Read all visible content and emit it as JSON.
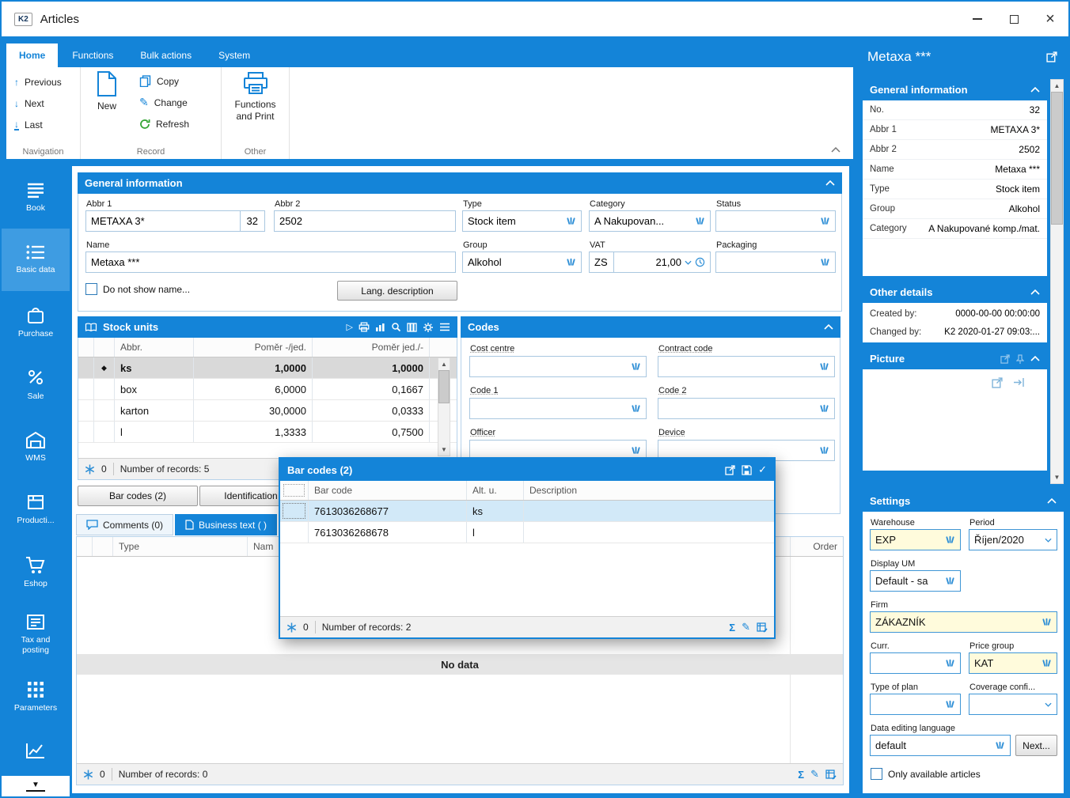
{
  "window": {
    "title": "Articles",
    "logo": "K2"
  },
  "icons": {
    "close": "×",
    "prev": "↑",
    "next": "↓",
    "last": "↓",
    "play": "▷",
    "check": "✓",
    "sigma": "Σ",
    "pencil": "✎",
    "diamond": "◆",
    "up": "▲",
    "down": "▼",
    "more": "▼"
  },
  "ribbon": {
    "tabs": [
      {
        "label": "Home"
      },
      {
        "label": "Functions"
      },
      {
        "label": "Bulk actions"
      },
      {
        "label": "System"
      }
    ],
    "groups": {
      "navigation": {
        "label": "Navigation",
        "previous": "Previous",
        "next": "Next",
        "last": "Last"
      },
      "record": {
        "label": "Record",
        "new": "New",
        "copy": "Copy",
        "change": "Change",
        "refresh": "Refresh"
      },
      "other": {
        "label": "Other",
        "functions_and_print": "Functions and Print"
      }
    }
  },
  "sidebar": {
    "items": [
      {
        "label": "Book"
      },
      {
        "label": "Basic data"
      },
      {
        "label": "Purchase"
      },
      {
        "label": "Sale"
      },
      {
        "label": "WMS"
      },
      {
        "label": "Producti..."
      },
      {
        "label": "Eshop"
      },
      {
        "label": "Tax and posting"
      },
      {
        "label": "Parameters"
      }
    ]
  },
  "general": {
    "title": "General information",
    "abbr1_label": "Abbr 1",
    "abbr1_value": "METAXA 3*",
    "abbr1_no": "32",
    "abbr2_label": "Abbr 2",
    "abbr2_value": "2502",
    "type_label": "Type",
    "type_value": "Stock item",
    "category_label": "Category",
    "category_value": "A Nakupovan...",
    "status_label": "Status",
    "name_label": "Name",
    "name_value": "Metaxa ***",
    "group_label": "Group",
    "group_value": "Alkohol",
    "vat_label": "VAT",
    "vat_code": "ZS",
    "vat_value": "21,00",
    "packaging_label": "Packaging",
    "do_not_show": "Do not show name...",
    "lang_button": "Lang. description"
  },
  "stock_units": {
    "title": "Stock units",
    "columns": [
      "Abbr.",
      "Poměr -/jed.",
      "Poměr jed./-"
    ],
    "rows": [
      {
        "abbr": "ks",
        "r1": "1,0000",
        "r2": "1,0000"
      },
      {
        "abbr": "box",
        "r1": "6,0000",
        "r2": "0,1667"
      },
      {
        "abbr": "karton",
        "r1": "30,0000",
        "r2": "0,0333"
      },
      {
        "abbr": "l",
        "r1": "1,3333",
        "r2": "0,7500"
      }
    ],
    "count": "0",
    "records": "Number of records: 5",
    "tab_barcodes": "Bar codes (2)",
    "tab_identification": "Identification n..."
  },
  "codes": {
    "title": "Codes",
    "cost_centre": "Cost centre",
    "contract_code": "Contract code",
    "code1": "Code 1",
    "code2": "Code 2",
    "officer": "Officer",
    "device": "Device"
  },
  "barcodes": {
    "title": "Bar codes (2)",
    "col_code": "Bar code",
    "col_alt": "Alt. u.",
    "col_desc": "Description",
    "rows": [
      {
        "code": "7613036268677",
        "alt": "ks"
      },
      {
        "code": "7613036268678",
        "alt": "l"
      }
    ],
    "count": "0",
    "records": "Number of records: 2"
  },
  "bottom": {
    "comments_tab": "Comments (0)",
    "business_tab": "Business text ( )",
    "col_type": "Type",
    "col_name": "Nam",
    "col_order": "Order",
    "no_data": "No data",
    "count": "0",
    "records": "Number of records: 0"
  },
  "right": {
    "title": "Metaxa ***",
    "general": {
      "title": "General information",
      "rows": [
        {
          "label": "No.",
          "value": "32"
        },
        {
          "label": "Abbr 1",
          "value": "METAXA 3*"
        },
        {
          "label": "Abbr 2",
          "value": "2502"
        },
        {
          "label": "Name",
          "value": "Metaxa ***"
        },
        {
          "label": "Type",
          "value": "Stock item"
        },
        {
          "label": "Group",
          "value": "Alkohol"
        },
        {
          "label": "Category",
          "value": "A Nakupované komp./mat."
        }
      ]
    },
    "other": {
      "title": "Other details",
      "rows": [
        {
          "label": "Created by:",
          "value": "0000-00-00 00:00:00"
        },
        {
          "label": "Changed by:",
          "value": "K2 2020-01-27 09:03:..."
        }
      ]
    },
    "picture": {
      "title": "Picture"
    },
    "settings": {
      "title": "Settings",
      "warehouse_label": "Warehouse",
      "warehouse_value": "EXP",
      "period_label": "Period",
      "period_value": "Říjen/2020",
      "display_um_label": "Display UM",
      "display_um_value": "Default - sa",
      "firm_label": "Firm",
      "firm_value": "ZÁKAZNÍK",
      "curr_label": "Curr.",
      "price_group_label": "Price group",
      "price_group_value": "KAT",
      "plan_label": "Type of plan",
      "coverage_label": "Coverage confi...",
      "lang_label": "Data editing language",
      "lang_value": "default",
      "next_button": "Next...",
      "only_available": "Only available articles"
    }
  }
}
